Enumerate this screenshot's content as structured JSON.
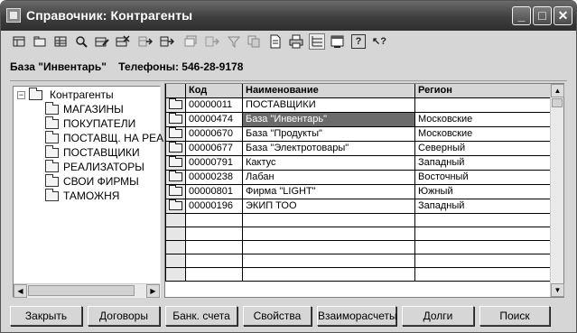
{
  "window": {
    "title": "Справочник: Контрагенты",
    "buttons": {
      "minimize": "_",
      "maximize": "□",
      "close": "✕"
    }
  },
  "toolbar": {
    "icons": [
      "new-icon",
      "open-folder-icon",
      "grid-icon",
      "find-icon",
      "edit-row-icon",
      "delete-row-icon",
      "move-icon",
      "copy-move-icon",
      "group-icon",
      "move-group-icon",
      "filter-icon",
      "copy-icon",
      "document-icon",
      "print-icon",
      "tree-view-icon",
      "window-icon",
      "help-icon",
      "context-help-icon"
    ],
    "help_glyph": "?",
    "context_help_glyph": "↖?"
  },
  "info": {
    "company": "База \"Инвентарь\"",
    "phones": "Телефоны: 546-28-9178"
  },
  "tree": {
    "root": "Контрагенты",
    "expander": "−",
    "items": [
      "МАГАЗИНЫ",
      "ПОКУПАТЕЛИ",
      "ПОСТАВЩ. НА РЕА",
      "ПОСТАВЩИКИ",
      "РЕАЛИЗАТОРЫ",
      "СВОИ ФИРМЫ",
      "ТАМОЖНЯ"
    ]
  },
  "grid": {
    "columns": [
      "",
      "Код",
      "Наименование",
      "Регион"
    ],
    "rows": [
      {
        "code": "00000011",
        "name": "ПОСТАВЩИКИ",
        "region": ""
      },
      {
        "code": "00000474",
        "name": "База \"Инвентарь\"",
        "region": "Московские"
      },
      {
        "code": "00000670",
        "name": "База \"Продукты\"",
        "region": "Московские"
      },
      {
        "code": "00000677",
        "name": "База \"Электротовары\"",
        "region": "Северный"
      },
      {
        "code": "00000791",
        "name": "Кактус",
        "region": "Западный"
      },
      {
        "code": "00000238",
        "name": "Лабан",
        "region": "Восточный"
      },
      {
        "code": "00000801",
        "name": "Фирма \"LIGHT\"",
        "region": "Южный"
      },
      {
        "code": "00000196",
        "name": "ЭКИП ТОО",
        "region": "Западный"
      }
    ],
    "selected_row": 1
  },
  "scroll": {
    "up": "▲",
    "down": "▼",
    "left": "◀",
    "right": "▶"
  },
  "footer": {
    "buttons": [
      "Закрыть",
      "Договоры",
      "Банк. счета",
      "Свойства",
      "Взаиморасчеты",
      "Долги",
      "Поиск"
    ]
  }
}
